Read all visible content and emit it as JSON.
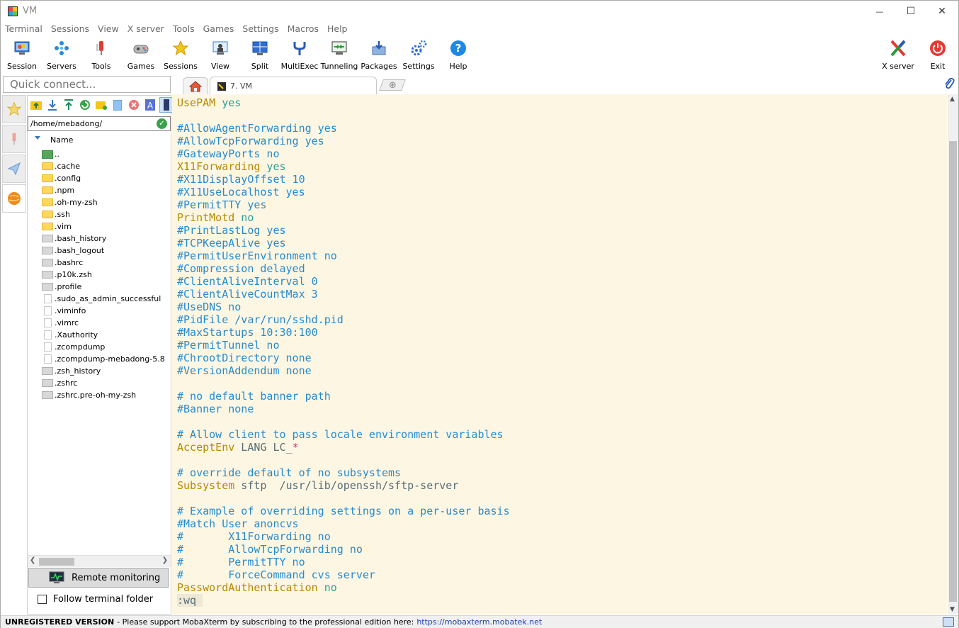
{
  "window": {
    "title": "VM",
    "controls": {
      "minimize": "—",
      "maximize": "☐",
      "close": "✕"
    }
  },
  "menubar": [
    "Terminal",
    "Sessions",
    "View",
    "X server",
    "Tools",
    "Games",
    "Settings",
    "Macros",
    "Help"
  ],
  "toolbar": {
    "items": [
      {
        "label": "Session",
        "icon": "session-icon"
      },
      {
        "label": "Servers",
        "icon": "servers-icon"
      },
      {
        "label": "Tools",
        "icon": "tools-icon"
      },
      {
        "label": "Games",
        "icon": "games-icon"
      },
      {
        "label": "Sessions",
        "icon": "star-icon"
      },
      {
        "label": "View",
        "icon": "view-icon"
      },
      {
        "label": "Split",
        "icon": "split-icon"
      },
      {
        "label": "MultiExec",
        "icon": "multiexec-icon"
      },
      {
        "label": "Tunneling",
        "icon": "tunneling-icon"
      },
      {
        "label": "Packages",
        "icon": "packages-icon"
      },
      {
        "label": "Settings",
        "icon": "gear-icon"
      },
      {
        "label": "Help",
        "icon": "help-icon"
      }
    ],
    "xserver_label": "X server",
    "exit_label": "Exit"
  },
  "quick_connect": {
    "placeholder": "Quick connect..."
  },
  "tabs": {
    "home_icon": "home-icon",
    "active_tab": "7. VM",
    "new_tab_icon": "plus-icon"
  },
  "sftp": {
    "path": "/home/mebadong/",
    "column_header": "Name",
    "files": [
      {
        "name": "..",
        "type": "up"
      },
      {
        "name": ".cache",
        "type": "folder"
      },
      {
        "name": ".config",
        "type": "folder"
      },
      {
        "name": ".npm",
        "type": "folder"
      },
      {
        "name": ".oh-my-zsh",
        "type": "folder"
      },
      {
        "name": ".ssh",
        "type": "folder"
      },
      {
        "name": ".vim",
        "type": "folder"
      },
      {
        "name": ".bash_history",
        "type": "file"
      },
      {
        "name": ".bash_logout",
        "type": "file"
      },
      {
        "name": ".bashrc",
        "type": "file"
      },
      {
        "name": ".p10k.zsh",
        "type": "file"
      },
      {
        "name": ".profile",
        "type": "file"
      },
      {
        "name": ".sudo_as_admin_successful",
        "type": "doc"
      },
      {
        "name": ".viminfo",
        "type": "doc"
      },
      {
        "name": ".vimrc",
        "type": "doc"
      },
      {
        "name": ".Xauthority",
        "type": "doc"
      },
      {
        "name": ".zcompdump",
        "type": "doc"
      },
      {
        "name": ".zcompdump-mebadong-5.8",
        "type": "doc"
      },
      {
        "name": ".zsh_history",
        "type": "file"
      },
      {
        "name": ".zshrc",
        "type": "file"
      },
      {
        "name": ".zshrc.pre-oh-my-zsh",
        "type": "file"
      }
    ],
    "remote_monitoring": "Remote monitoring",
    "follow_folder": "Follow terminal folder"
  },
  "terminal": {
    "lines": [
      [
        [
          "kw",
          "UsePAM"
        ],
        [
          "val",
          " yes"
        ]
      ],
      [],
      [
        [
          "c",
          "#AllowAgentForwarding yes"
        ]
      ],
      [
        [
          "c",
          "#AllowTcpForwarding yes"
        ]
      ],
      [
        [
          "c",
          "#GatewayPorts no"
        ]
      ],
      [
        [
          "kw",
          "X11Forwarding"
        ],
        [
          "val",
          " yes"
        ]
      ],
      [
        [
          "c",
          "#X11DisplayOffset 10"
        ]
      ],
      [
        [
          "c",
          "#X11UseLocalhost yes"
        ]
      ],
      [
        [
          "c",
          "#PermitTTY yes"
        ]
      ],
      [
        [
          "kw",
          "PrintMotd"
        ],
        [
          "val",
          " no"
        ]
      ],
      [
        [
          "c",
          "#PrintLastLog yes"
        ]
      ],
      [
        [
          "c",
          "#TCPKeepAlive yes"
        ]
      ],
      [
        [
          "c",
          "#PermitUserEnvironment no"
        ]
      ],
      [
        [
          "c",
          "#Compression delayed"
        ]
      ],
      [
        [
          "c",
          "#ClientAliveInterval 0"
        ]
      ],
      [
        [
          "c",
          "#ClientAliveCountMax 3"
        ]
      ],
      [
        [
          "c",
          "#UseDNS no"
        ]
      ],
      [
        [
          "c",
          "#PidFile /var/run/sshd.pid"
        ]
      ],
      [
        [
          "c",
          "#MaxStartups 10:30:100"
        ]
      ],
      [
        [
          "c",
          "#PermitTunnel no"
        ]
      ],
      [
        [
          "c",
          "#ChrootDirectory none"
        ]
      ],
      [
        [
          "c",
          "#VersionAddendum none"
        ]
      ],
      [],
      [
        [
          "c",
          "# no default banner path"
        ]
      ],
      [
        [
          "c",
          "#Banner none"
        ]
      ],
      [],
      [
        [
          "c",
          "# Allow client to pass locale environment variables"
        ]
      ],
      [
        [
          "kw",
          "AcceptEnv"
        ],
        [
          "plain",
          " LANG LC_"
        ],
        [
          "mag",
          "*"
        ]
      ],
      [],
      [
        [
          "c",
          "# override default of no subsystems"
        ]
      ],
      [
        [
          "kw",
          "Subsystem"
        ],
        [
          "plain",
          " sftp  /usr/lib/openssh/sftp-server"
        ]
      ],
      [],
      [
        [
          "c",
          "# Example of overriding settings on a per-user basis"
        ]
      ],
      [
        [
          "c",
          "#Match User anoncvs"
        ]
      ],
      [
        [
          "c",
          "#       X11Forwarding no"
        ]
      ],
      [
        [
          "c",
          "#       AllowTcpForwarding no"
        ]
      ],
      [
        [
          "c",
          "#       PermitTTY no"
        ]
      ],
      [
        [
          "c",
          "#       ForceCommand cvs server"
        ]
      ],
      [
        [
          "kw",
          "PasswordAuthentication"
        ],
        [
          "val",
          " no"
        ]
      ],
      [
        [
          "cmd",
          ":wq "
        ]
      ]
    ]
  },
  "statusbar": {
    "label": "UNREGISTERED VERSION",
    "message": "  -  Please support MobaXterm by subscribing to the professional edition here:",
    "link": "https://mobaxterm.mobatek.net"
  },
  "colors": {
    "terminal_bg": "#fdf6e3",
    "comment": "#268bd2",
    "keyword": "#b58900",
    "value": "#2aa198",
    "plain": "#586e75"
  }
}
